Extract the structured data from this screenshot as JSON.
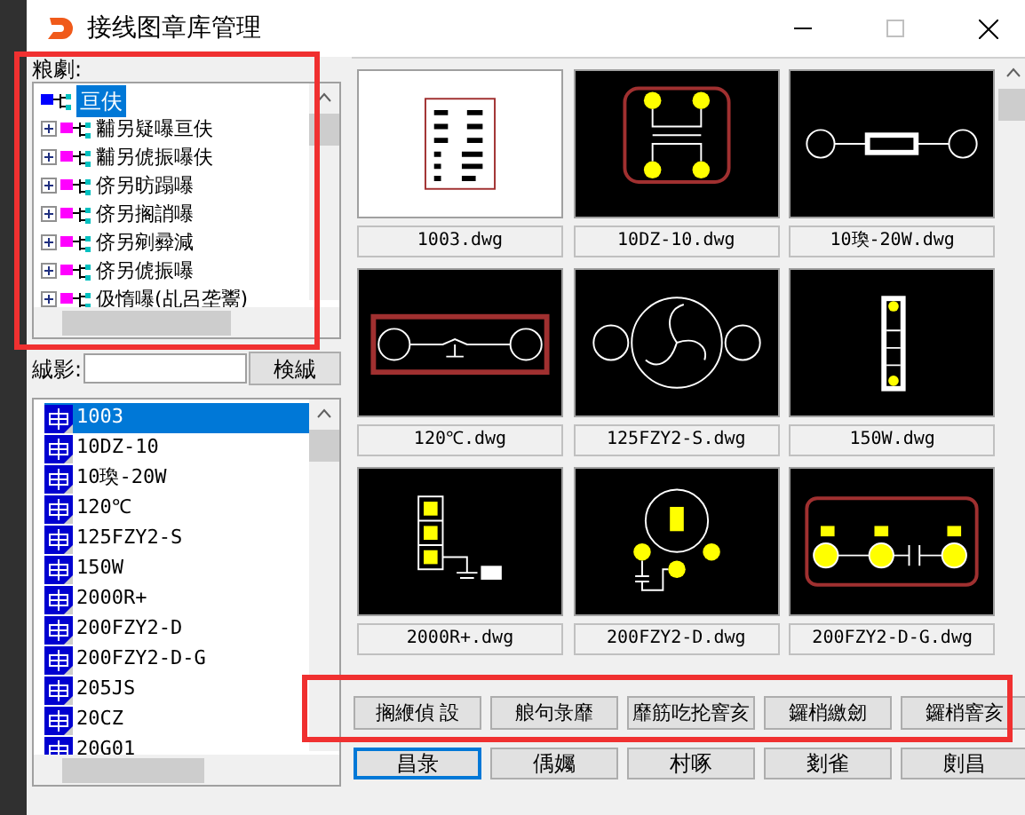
{
  "window": {
    "title": "接线图章库管理"
  },
  "tree": {
    "label": "粮劇:",
    "highlighted": true,
    "root": {
      "label": "亘伕",
      "selected": true,
      "children": [
        {
          "label": "黼另疑嚗亘伕",
          "expanded": false
        },
        {
          "label": "黼另俿振嚗伕",
          "expanded": false
        },
        {
          "label": "侪另昉蹋嚗",
          "expanded": false
        },
        {
          "label": "侪另搁誚嚗",
          "expanded": false
        },
        {
          "label": "侪另剜彛減",
          "expanded": false
        },
        {
          "label": "侪另俿振嚗",
          "expanded": false
        },
        {
          "label": "伋惰嚗(乩呂垄鬻)",
          "expanded": false
        }
      ]
    }
  },
  "search": {
    "label": "絾影:",
    "button": "検絾"
  },
  "symbols": [
    {
      "name": "1003",
      "selected": true
    },
    {
      "name": "10DZ-10",
      "selected": false
    },
    {
      "name": "10瑍-20W",
      "selected": false
    },
    {
      "name": "120℃",
      "selected": false
    },
    {
      "name": "125FZY2-S",
      "selected": false
    },
    {
      "name": "150W",
      "selected": false
    },
    {
      "name": "2000R+",
      "selected": false
    },
    {
      "name": "200FZY2-D",
      "selected": false
    },
    {
      "name": "200FZY2-D-G",
      "selected": false
    },
    {
      "name": "205JS",
      "selected": false
    },
    {
      "name": "20CZ",
      "selected": false
    },
    {
      "name": "20G01",
      "selected": false
    }
  ],
  "thumbnails": [
    {
      "file": "1003.dwg",
      "kind": "table"
    },
    {
      "file": "10DZ-10.dwg",
      "kind": "transformer"
    },
    {
      "file": "10瑍-20W.dwg",
      "kind": "resistor"
    },
    {
      "file": "120℃.dwg",
      "kind": "thermostat"
    },
    {
      "file": "125FZY2-S.dwg",
      "kind": "fan"
    },
    {
      "file": "150W.dwg",
      "kind": "heater"
    },
    {
      "file": "2000R+.dwg",
      "kind": "plug"
    },
    {
      "file": "200FZY2-D.dwg",
      "kind": "motor"
    },
    {
      "file": "200FZY2-D-G.dwg",
      "kind": "capacitor"
    }
  ],
  "actions": {
    "highlighted": true,
    "buttons": [
      "搁緶偵 設",
      "艆句彔靡",
      "靡筋吃抡窨亥",
      "鑼梢繳劒",
      "鑼梢窨亥"
    ]
  },
  "bottom_buttons": [
    {
      "label": "昌彔",
      "selected": true
    },
    {
      "label": "偊孎",
      "selected": false
    },
    {
      "label": "村啄",
      "selected": false
    },
    {
      "label": "剗雀",
      "selected": false
    },
    {
      "label": "剫昌",
      "selected": false
    }
  ]
}
